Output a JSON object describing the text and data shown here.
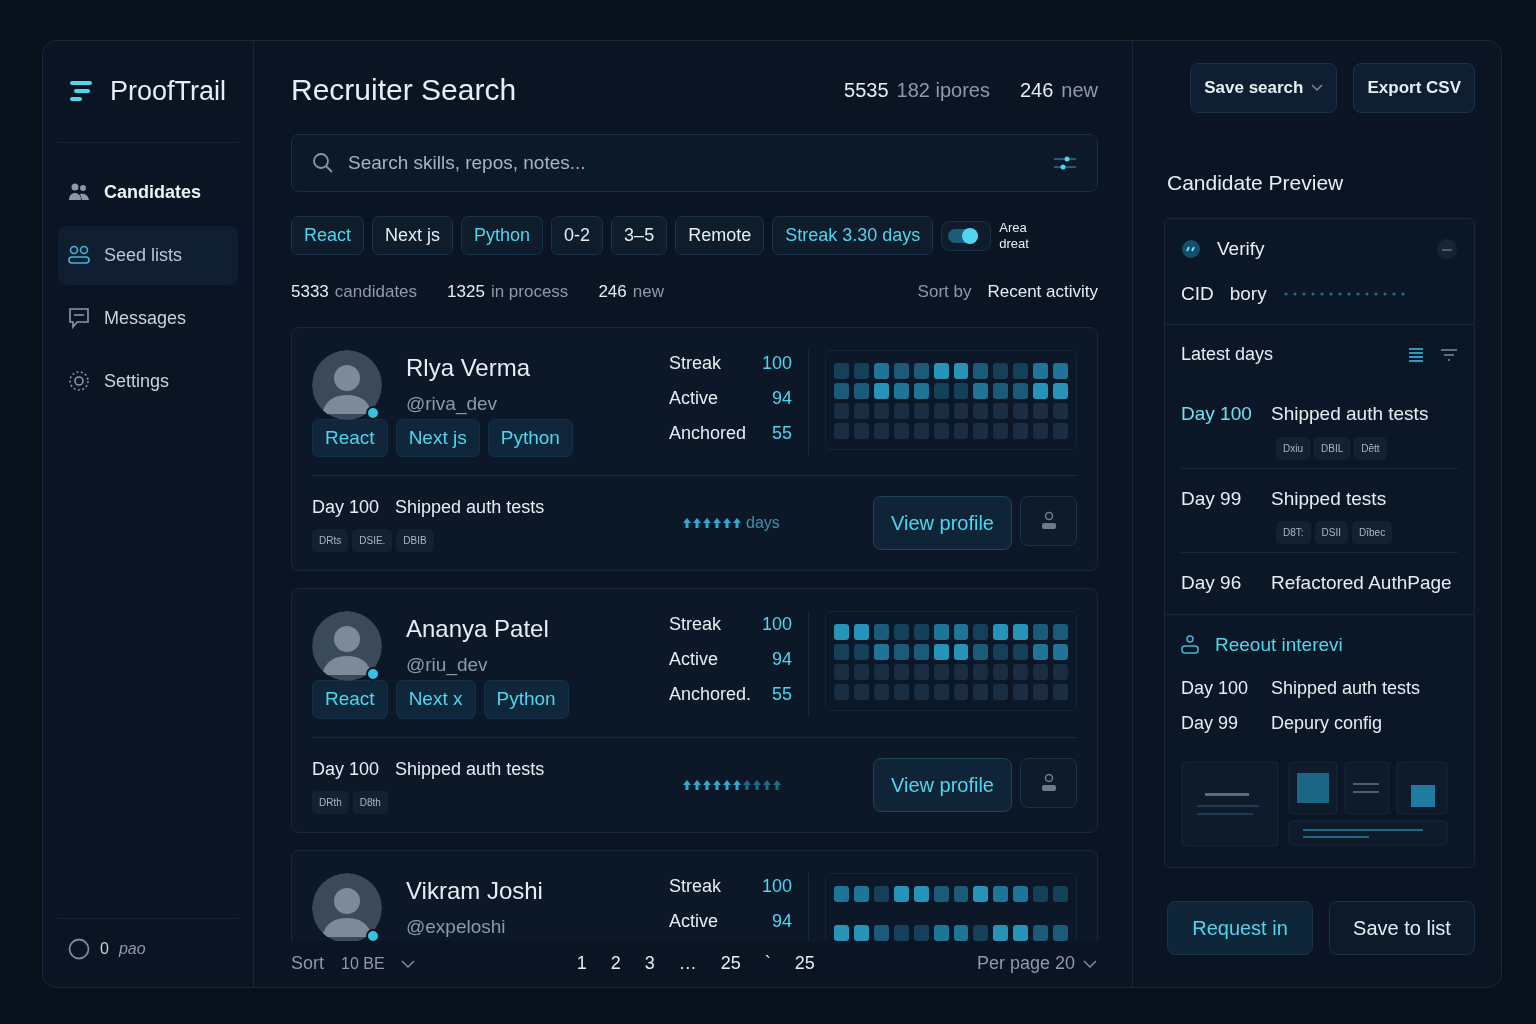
{
  "sidebar": {
    "logo": "ProofTrail",
    "items": [
      {
        "label": "Candidates",
        "selected": false,
        "bold": true
      },
      {
        "label": "Seed lists",
        "selected": true,
        "bold": false
      },
      {
        "label": "Messages",
        "selected": false,
        "bold": false
      },
      {
        "label": "Settings",
        "selected": false,
        "bold": false
      }
    ],
    "footer": {
      "count": "0",
      "label": "pao"
    }
  },
  "header": {
    "title": "Recruiter Search",
    "stats": [
      {
        "number": "5535",
        "caption": "182 ipores"
      },
      {
        "number": "246",
        "caption": "new"
      }
    ]
  },
  "search": {
    "placeholder": "Search skills, repos, notes..."
  },
  "filters": [
    {
      "label": "React",
      "selected": true
    },
    {
      "label": "Next js",
      "selected": false
    },
    {
      "label": "Python",
      "selected": true
    },
    {
      "label": "0-2",
      "selected": false
    },
    {
      "label": "3–5",
      "selected": false
    },
    {
      "label": "Remote",
      "selected": false
    },
    {
      "label": "Streak 3.30 days",
      "selected": true
    }
  ],
  "toggle": {
    "on": true,
    "label": "Area dreat"
  },
  "summary": {
    "counts": [
      {
        "number": "5333",
        "caption": "candidates"
      },
      {
        "number": "1325",
        "caption": "in process"
      },
      {
        "number": "246",
        "caption": "new"
      }
    ],
    "sort_label": "Sort by",
    "sort_value": "Recent activity"
  },
  "candidates": [
    {
      "name": "Rlya Verma",
      "handle": "@riva_dev",
      "online": true,
      "tags": [
        "React",
        "Next js",
        "Python"
      ],
      "stats": [
        {
          "label": "Streak",
          "value": "100"
        },
        {
          "label": "Active",
          "value": "94"
        },
        {
          "label": "Anchored",
          "value": "55"
        }
      ],
      "day": "Day 100",
      "note": "Shipped auth tests",
      "artifacts": [
        "DRts",
        "DSIE.",
        "DBIB"
      ],
      "streak_text": "days",
      "button": "View profile"
    },
    {
      "name": "Ananya Patel",
      "handle": "@riu_dev",
      "online": true,
      "tags": [
        "React",
        "Next x",
        "Python"
      ],
      "stats": [
        {
          "label": "Streak",
          "value": "100"
        },
        {
          "label": "Active",
          "value": "94"
        },
        {
          "label": "Anchored.",
          "value": "55"
        }
      ],
      "day": "Day 100",
      "note": "Shipped auth tests",
      "artifacts": [
        "DRth",
        "D8th"
      ],
      "button": "View profile"
    },
    {
      "name": "Vikram Joshi",
      "handle": "@expeloshi",
      "online": true,
      "stats": [
        {
          "label": "Streak",
          "value": "100"
        },
        {
          "label": "Active",
          "value": "94"
        }
      ]
    }
  ],
  "pagination": {
    "sort": "Sort",
    "sort_value": "10 BE",
    "pages": [
      {
        "label": "1",
        "selected": false
      },
      {
        "label": "2",
        "selected": false
      },
      {
        "label": "3",
        "selected": false
      },
      {
        "label": "…",
        "selected": false
      },
      {
        "label": "25",
        "selected": false
      },
      {
        "label": "`",
        "selected": false
      },
      {
        "label": "25",
        "selected": false
      }
    ],
    "per_page": "Per page 20"
  },
  "actions": [
    "Save search",
    "Export CSV"
  ],
  "preview": {
    "title": "Candidate Preview",
    "verify": "Verify",
    "cid_label": "CID",
    "cid_value": "bory",
    "latest_title": "Latest days",
    "latest": [
      {
        "day": "Day 100",
        "note": "Shipped auth tests",
        "artifacts": [
          "Dxiu",
          "DBIL",
          "Dĕtt"
        ]
      },
      {
        "day": "Day 99",
        "note": "Shipped tests",
        "artifacts": [
          "D8T:",
          "DSII",
          "Dībec"
        ]
      },
      {
        "day": "Day 96",
        "note": "Refactored AuthPage"
      }
    ],
    "interview_title": "Reeout interevi",
    "interview": [
      {
        "day": "Day 100",
        "note": "Shipped auth tests"
      },
      {
        "day": "Day 99",
        "note": "Depury config"
      }
    ],
    "buttons": [
      {
        "label": "Request in",
        "primary": true
      },
      {
        "label": "Save to list",
        "primary": false
      }
    ]
  }
}
